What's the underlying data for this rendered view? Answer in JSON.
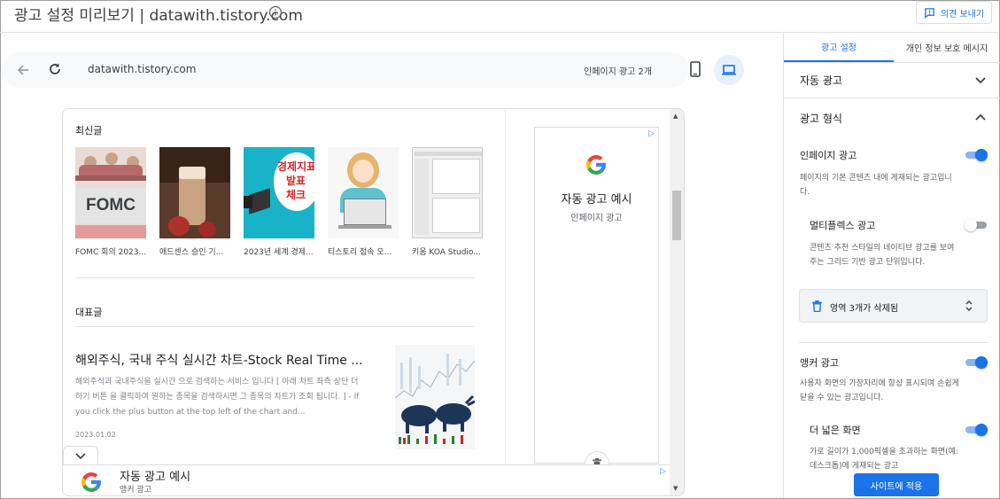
{
  "header": {
    "title": "광고 설정 미리보기 | datawith.tistory.com",
    "feedback_label": "의견 보내기"
  },
  "browser": {
    "url": "datawith.tistory.com",
    "ad_count": "인페이지 광고 2개"
  },
  "blog": {
    "latest_heading": "최신글",
    "thumbnails": [
      {
        "caption": "FOMC 회의 2023...",
        "image_text": "FOMC"
      },
      {
        "caption": "애드센스 승인 기..."
      },
      {
        "caption": "2023년 세계 경제...",
        "image_text": "경제지표 발표 체크"
      },
      {
        "caption": "티스토리 접속 오..."
      },
      {
        "caption": "키움 KOA Studio..."
      }
    ],
    "featured_heading": "대표글",
    "post": {
      "title": "해외주식, 국내 주식 실시간 차트-Stock Real Time ...",
      "body": "해외주식과 국내주식을 실시간 으로 검색하는 서비스 입니다 [ 아래 차트 좌측 상단 더하기 버튼 을 클릭하여 원하는 종목을 검색하시면 그 종목의 차트가 조회 됩니다. ] - If you click the plus button at the top left of the chart and...",
      "date": "2023.01.02"
    }
  },
  "side_ad": {
    "title": "자동 광고 예시",
    "subtitle": "인페이지 광고"
  },
  "anchor_ad": {
    "title": "자동 광고 예시",
    "subtitle": "앵커 광고"
  },
  "panel": {
    "tabs": [
      {
        "label": "광고 설정",
        "active": true
      },
      {
        "label": "개인 정보 보호 메시지",
        "active": false
      }
    ],
    "auto_ads_label": "자동 광고",
    "ad_format_label": "광고 형식",
    "inpage": {
      "label": "인페이지 광고",
      "desc": "페이지의 기본 콘텐츠 내에 게재되는 광고입니다.",
      "enabled": true
    },
    "multiplex": {
      "label": "멀티플렉스 광고",
      "desc": "콘텐츠 추천 스타일의 네이티브 광고를 보여 주는 그리드 기반 광고 단위입니다.",
      "enabled": false
    },
    "area_select": "영역 3개가 삭제됨",
    "anchor": {
      "label": "앵커 광고",
      "desc": "사용자 화면의 가장자리에 항상 표시되며 손쉽게 닫을 수 있는 광고입니다.",
      "enabled": true
    },
    "wide_screen": {
      "label": "더 넓은 화면",
      "desc": "가로 길이가 1,000픽셀을 초과하는 화면(예: 데스크톱)에 게재되는 광고",
      "enabled": true
    },
    "apply_label": "사이트에 적용"
  },
  "colors": {
    "accent": "#1a73e8",
    "toggle_track_on": "#8ab4f8"
  }
}
